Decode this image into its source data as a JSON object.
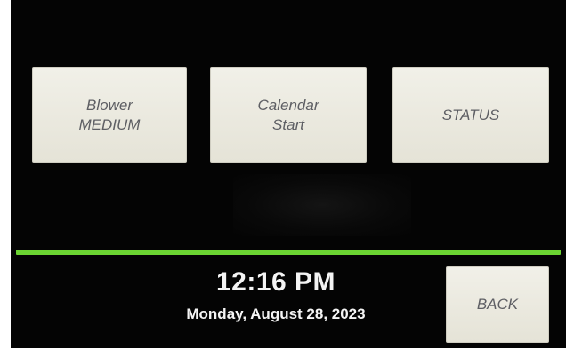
{
  "buttons": {
    "blower": {
      "line1": "Blower",
      "line2": "MEDIUM"
    },
    "calendar": {
      "line1": "Calendar",
      "line2": "Start"
    },
    "status": {
      "label": "STATUS"
    },
    "back": {
      "label": "BACK"
    }
  },
  "clock": {
    "time": "12:16 PM",
    "date": "Monday, August 28, 2023"
  },
  "colors": {
    "background": "#040404",
    "divider": "#6bd432",
    "button_face": "#ece9df",
    "button_text": "#5e5f64"
  }
}
